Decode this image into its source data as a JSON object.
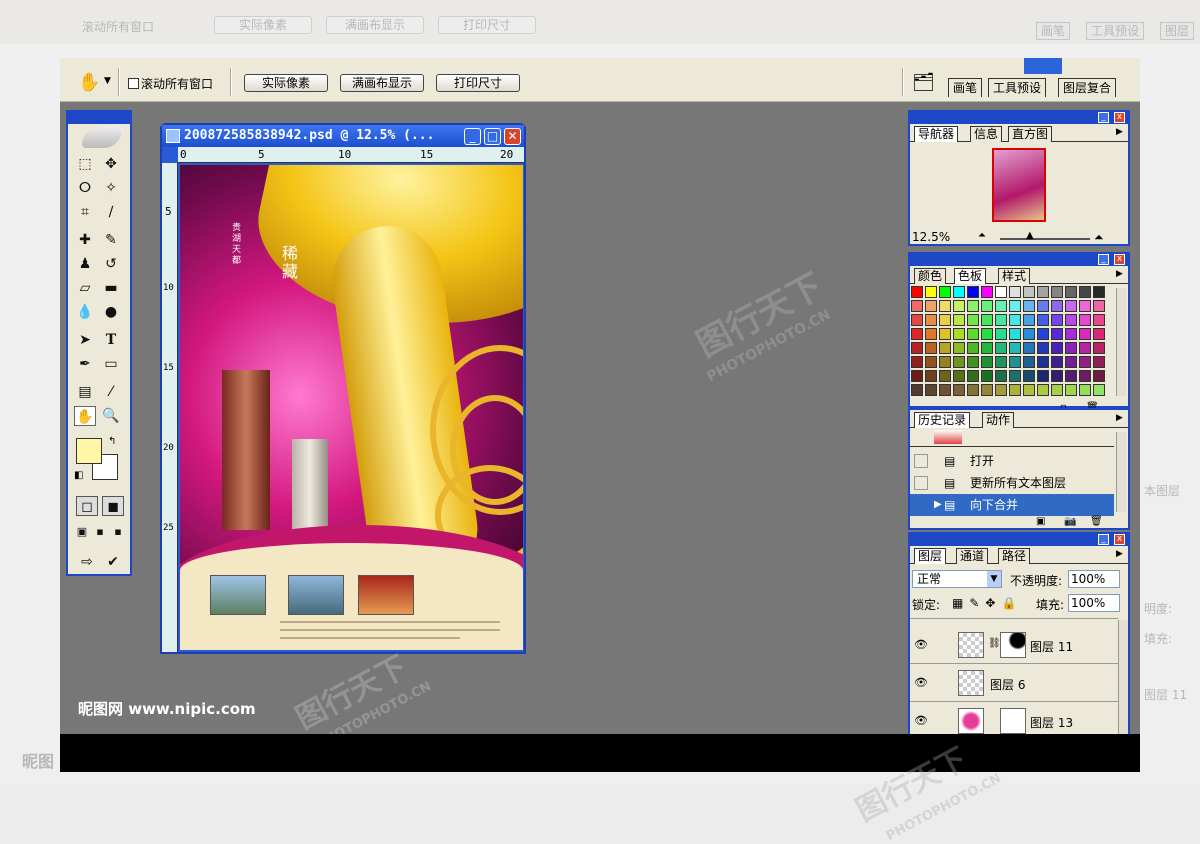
{
  "options_bar": {
    "scroll_all_label": "滚动所有窗口",
    "btn_actual_pixels": "实际像素",
    "btn_fit_screen": "满画布显示",
    "btn_print_size": "打印尺寸",
    "well_tabs": [
      "画笔",
      "工具预设",
      "图层复合"
    ]
  },
  "background_shot": {
    "scroll_all_label": "滚动所有窗口",
    "btn_actual_pixels": "实际像素",
    "btn_fit_screen": "满画布显示",
    "btn_print_size": "打印尺寸",
    "well_tabs": [
      "画笔",
      "工具预设",
      "图层"
    ],
    "side_labels": [
      "本图层",
      "明度:",
      "填充:",
      "图层 11"
    ],
    "bottom_brand": "昵图"
  },
  "document": {
    "title": "20087258583894​2.psd @ 12.5% (...",
    "ruler_top": [
      "0",
      "5",
      "10",
      "15",
      "20"
    ],
    "ruler_left": [
      "5",
      "10",
      "15",
      "20",
      "25"
    ],
    "poster_text": {
      "vertical_small": "贵湖天都",
      "headline": "稀藏"
    }
  },
  "navigator": {
    "tabs": [
      "导航器",
      "信息",
      "直方图"
    ],
    "zoom": "12.5%"
  },
  "color_panel": {
    "tabs": [
      "颜色",
      "色板",
      "样式"
    ]
  },
  "history": {
    "tabs": [
      "历史记录",
      "动作"
    ],
    "items": [
      "打开",
      "更新所有文本图层",
      "向下合并"
    ],
    "selected_index": 2
  },
  "layers": {
    "tabs": [
      "图层",
      "通道",
      "路径"
    ],
    "blend_mode": "正常",
    "opacity_label": "不透明度:",
    "opacity_value": "100%",
    "lock_label": "锁定:",
    "fill_label": "填充:",
    "fill_value": "100%",
    "rows": [
      "图层 11",
      "图层 6",
      "图层 13"
    ]
  },
  "watermark": {
    "site": "昵图网 www.nipic.com",
    "brand": "图行天下",
    "brand_en": "PHOTOPHOTO.CN"
  },
  "colors": {
    "xp_blue": "#1c47c7",
    "panel_bg": "#ece9d8",
    "workspace": "#777777",
    "selected_history": "#316ac5"
  }
}
